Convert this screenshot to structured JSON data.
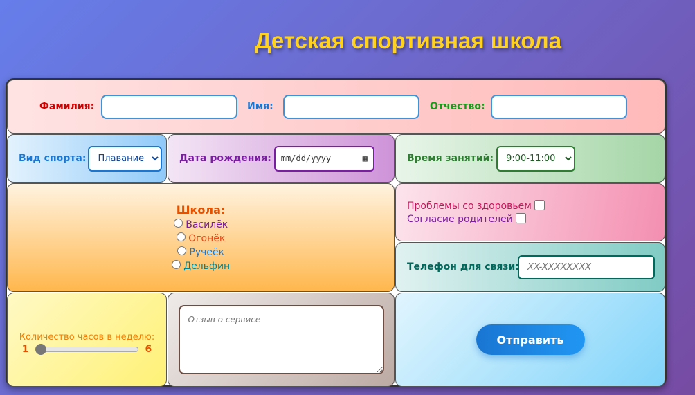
{
  "title": "Детская спортивная школа",
  "name_row": {
    "surname_label": "Фамилия:",
    "name_label": "Имя:",
    "patronymic_label": "Отчество:"
  },
  "sport": {
    "label": "Вид спорта:",
    "selected": "Плавание"
  },
  "birth": {
    "label": "Дата рождения:",
    "placeholder": "mm/dd/yyyy"
  },
  "time": {
    "label": "Время занятий:",
    "selected": "9:00-11:00"
  },
  "school": {
    "label": "Школа:",
    "options": [
      "Василёк",
      "Огонёк",
      "Ручеёк",
      "Дельфин"
    ]
  },
  "checks": {
    "health": "Проблемы со здоровьем",
    "consent": "Согласие родителей"
  },
  "phone": {
    "label": "Телефон для связи:",
    "placeholder": "XX-XXXXXXXX"
  },
  "hours": {
    "label": "Количество часов в неделю:",
    "min": "1",
    "max": "6",
    "value": 1
  },
  "review": {
    "placeholder": "Отзыв о сервисе"
  },
  "submit": "Отправить"
}
